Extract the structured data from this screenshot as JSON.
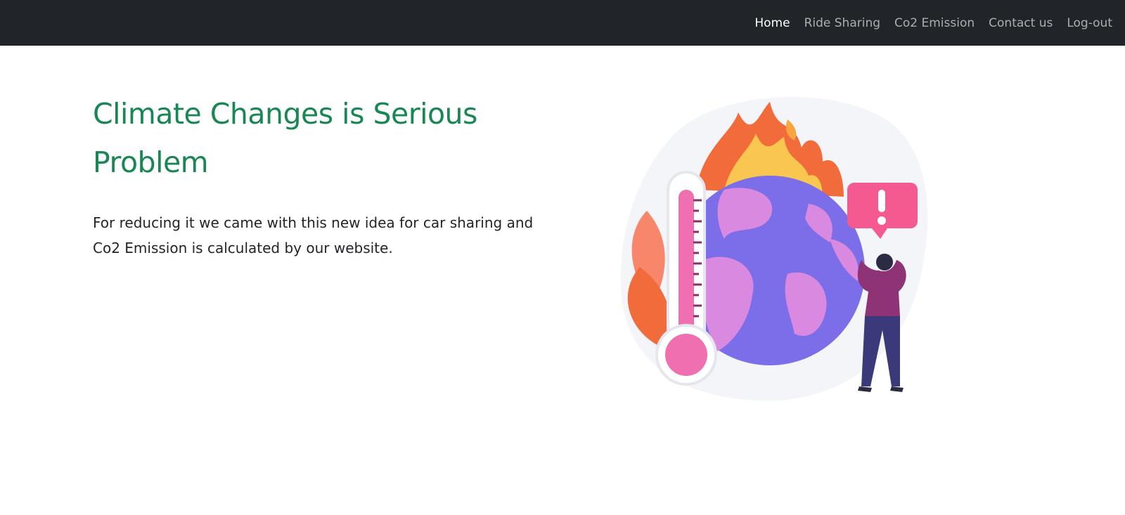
{
  "nav": {
    "items": [
      {
        "label": "Home",
        "active": true
      },
      {
        "label": "Ride Sharing",
        "active": false
      },
      {
        "label": "Co2 Emission",
        "active": false
      },
      {
        "label": "Contact us",
        "active": false
      },
      {
        "label": "Log-out",
        "active": false
      }
    ]
  },
  "hero": {
    "title": "Climate Changes is Serious Problem",
    "description": "For reducing it we came with this new idea for car sharing and Co2 Emission is calculated by our website."
  },
  "illustration": {
    "icon": "global-warming-illustration",
    "colors": {
      "nav_bg": "#212529",
      "title": "#198754",
      "globe": "#7b6ee8",
      "land": "#d98ae0",
      "flame_outer": "#f26b3a",
      "flame_inner": "#f9c74f",
      "thermometer": "#f06fb0",
      "alert": "#f4598f"
    }
  }
}
